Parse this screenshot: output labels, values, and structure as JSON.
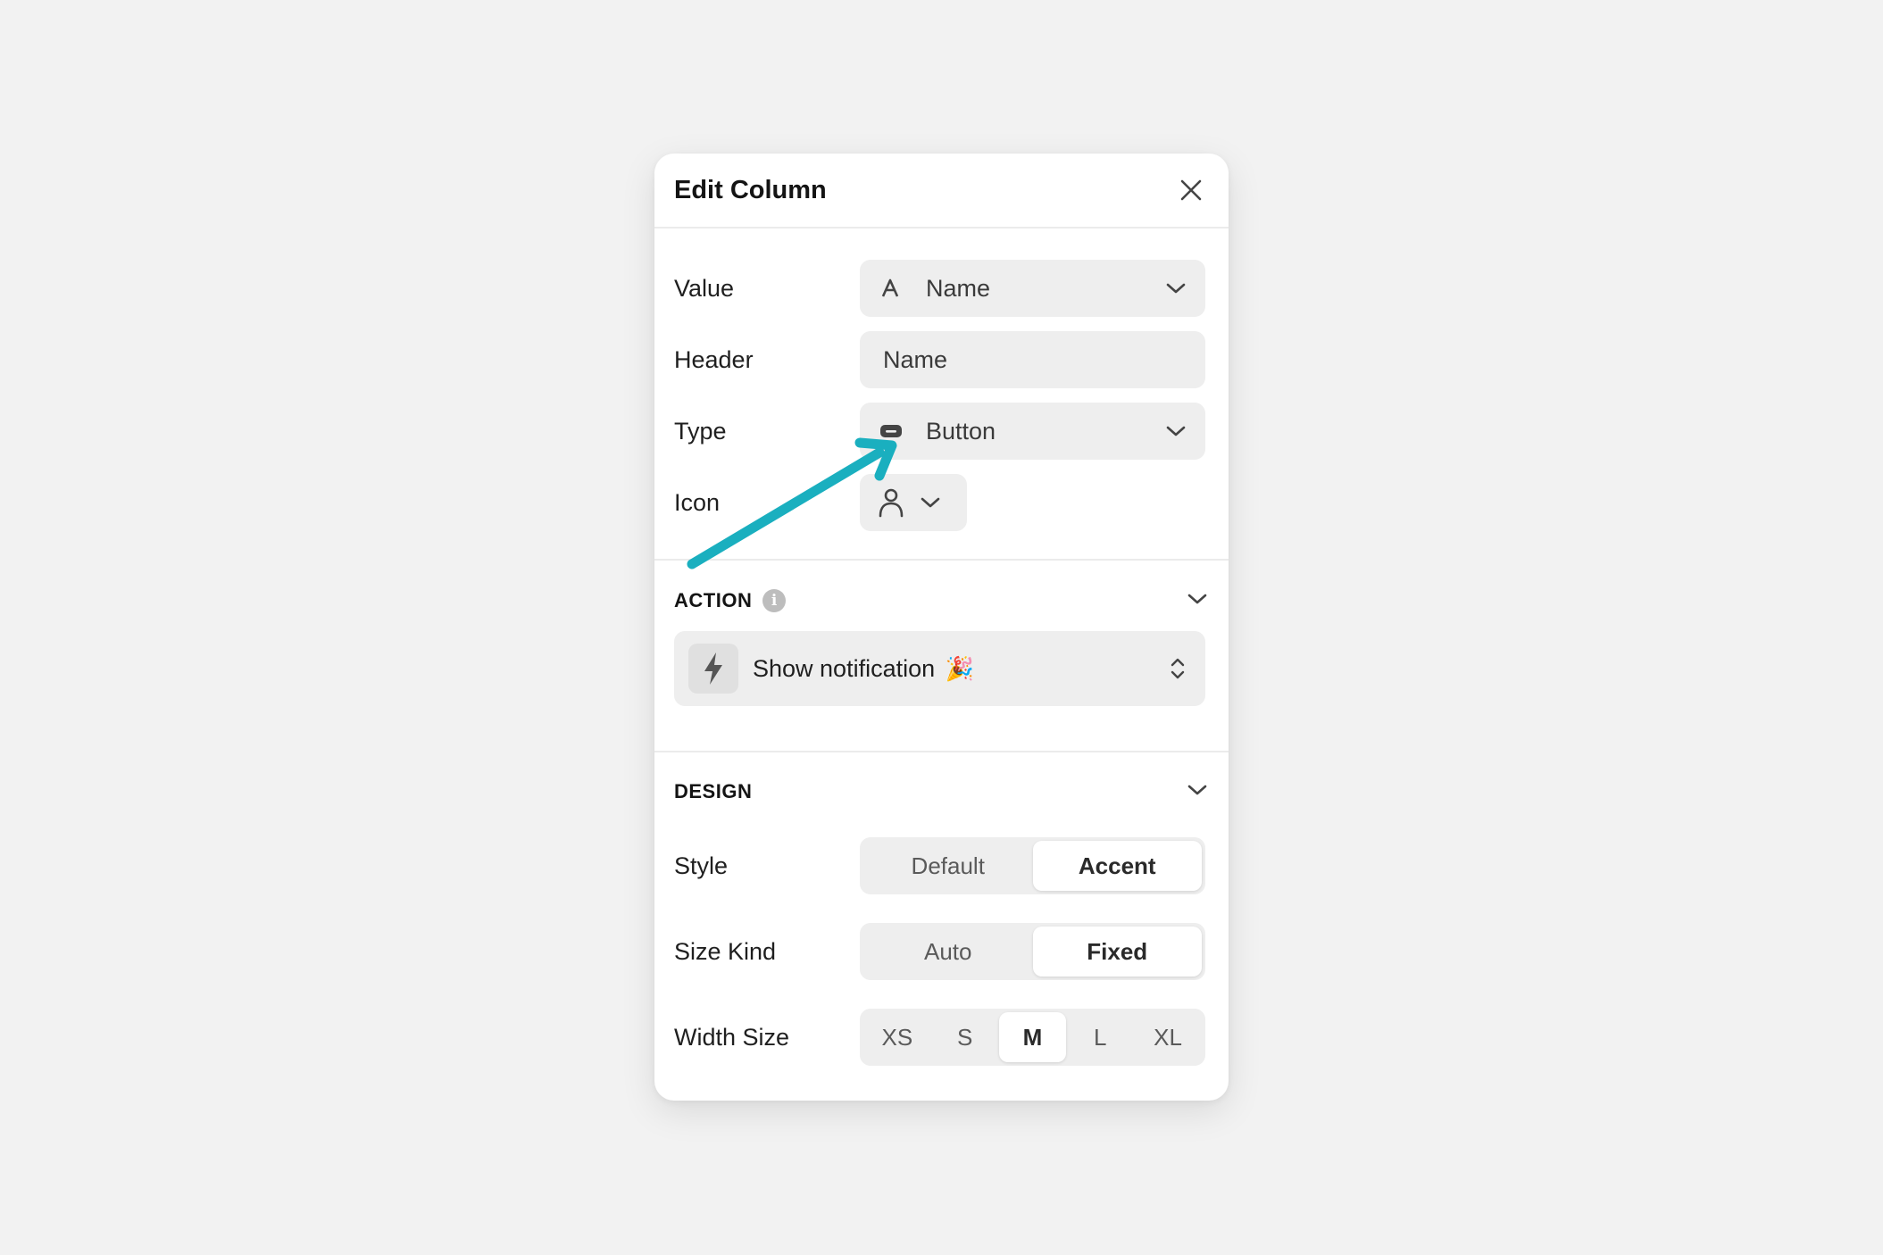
{
  "dialog": {
    "title": "Edit Column"
  },
  "fields": {
    "value": {
      "label": "Value",
      "selected": "Name",
      "icon": "text-a-icon"
    },
    "header": {
      "label": "Header",
      "value": "Name"
    },
    "type": {
      "label": "Type",
      "selected": "Button",
      "icon": "button-icon"
    },
    "icon": {
      "label": "Icon",
      "selected_icon": "person-icon"
    }
  },
  "action": {
    "section_title": "ACTION",
    "info_icon": "info-icon",
    "selected": "Show notification",
    "emoji": "🎉",
    "icon": "bolt-icon"
  },
  "design": {
    "section_title": "DESIGN",
    "style": {
      "label": "Style",
      "options": [
        "Default",
        "Accent"
      ],
      "selected": "Accent"
    },
    "size_kind": {
      "label": "Size Kind",
      "options": [
        "Auto",
        "Fixed"
      ],
      "selected": "Fixed"
    },
    "width_size": {
      "label": "Width Size",
      "options": [
        "XS",
        "S",
        "M",
        "L",
        "XL"
      ],
      "selected": "M"
    }
  },
  "annotation": {
    "arrow_color": "#1aafbf"
  },
  "colors": {
    "background": "#f2f2f2",
    "panel": "#ffffff",
    "field": "#eeeeee"
  }
}
